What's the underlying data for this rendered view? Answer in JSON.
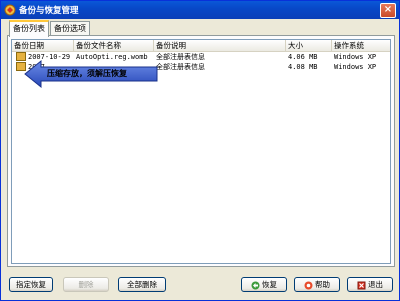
{
  "window": {
    "title": "备份与恢复管理",
    "close_glyph": "×"
  },
  "tabs": [
    {
      "label": "备份列表"
    },
    {
      "label": "备份选项"
    }
  ],
  "columns": [
    {
      "label": "备份日期"
    },
    {
      "label": "备份文件名称"
    },
    {
      "label": "备份说明"
    },
    {
      "label": "大小"
    },
    {
      "label": "操作系统"
    }
  ],
  "rows": [
    {
      "date": "2007-10-29",
      "filename": "AutoOpti.reg.womb",
      "desc": "全部注册表信息",
      "size": "4.06 MB",
      "os": "Windows XP"
    },
    {
      "date": "2007",
      "filename": "",
      "desc": "全部注册表信息",
      "size": "4.08 MB",
      "os": "Windows XP"
    }
  ],
  "callout": {
    "text": "压缩存放，须解压恢复"
  },
  "buttons": {
    "restore_specified": "指定恢复",
    "delete": "删除",
    "delete_all": "全部删除",
    "restore": "恢复",
    "help": "帮助",
    "exit": "退出"
  },
  "colors": {
    "accent": "#0a58d8",
    "callout_fill": "#3458c8"
  }
}
